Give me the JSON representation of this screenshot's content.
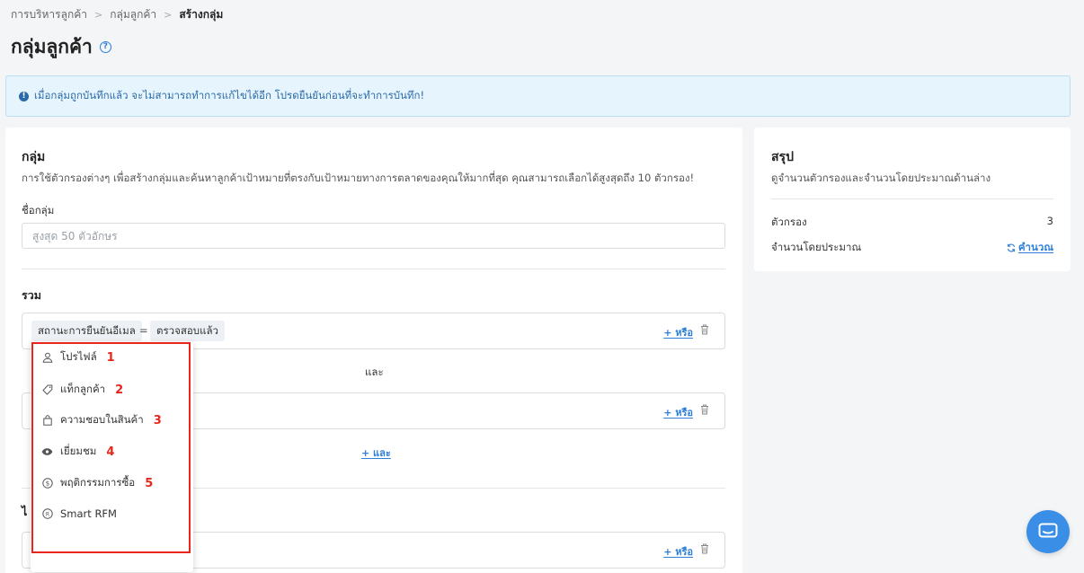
{
  "breadcrumb": {
    "items": [
      "การบริหารลูกค้า",
      "กลุ่มลูกค้า"
    ],
    "current": "สร้างกลุ่ม"
  },
  "page": {
    "title": "กลุ่มลูกค้า"
  },
  "banner": {
    "text": "เมื่อกลุ่มถูกบันทึกแล้ว จะไม่สามารถทำการแก้ไขได้อีก โปรดยืนยันก่อนที่จะทำการบันทึก!"
  },
  "group_card": {
    "title": "กลุ่ม",
    "description": "การใช้ตัวกรองต่างๆ เพื่อสร้างกลุ่มและค้นหาลูกค้าเป้าหมายที่ตรงกับเป้าหมายทางการตลาดของคุณให้มากที่สุด คุณสามารถเลือกได้สูงสุดถึง 10 ตัวกรอง!",
    "name_label": "ชื่อกลุ่ม",
    "name_placeholder": "สูงสุด 50 ตัวอักษร",
    "include_label": "รวม",
    "condition1": {
      "field": "สถานะการยืนยันอีเมล",
      "operator": "=",
      "value": "ตรวจสอบแล้ว"
    },
    "or_label": "+ หรือ",
    "and_connector": "และ",
    "add_and_label": "+ และ",
    "exclude_label_peek": "ไ"
  },
  "dropdown": {
    "items": [
      {
        "label": "โปรไฟล์",
        "icon": "user-icon",
        "number": "1"
      },
      {
        "label": "แท็กลูกค้า",
        "icon": "tag-icon",
        "number": "2"
      },
      {
        "label": "ความชอบในสินค้า",
        "icon": "shopping-bag-icon",
        "number": "3"
      },
      {
        "label": "เยี่ยมชม",
        "icon": "eye-icon",
        "number": "4"
      },
      {
        "label": "พฤติกรรมการซื้อ",
        "icon": "dollar-circle-icon",
        "number": "5"
      },
      {
        "label": "Smart RFM",
        "icon": "rfm-icon",
        "number": ""
      }
    ]
  },
  "summary": {
    "title": "สรุป",
    "description": "ดูจำนวนตัวกรองและจำนวนโดยประมาณด้านล่าง",
    "filters_label": "ตัวกรอง",
    "filters_value": "3",
    "estimate_label": "จำนวนโดยประมาณ",
    "calculate_label": "คำนวณ"
  },
  "colors": {
    "accent": "#2d7fd8",
    "highlight": "#e8261c",
    "banner_bg": "#e6f4fd"
  }
}
